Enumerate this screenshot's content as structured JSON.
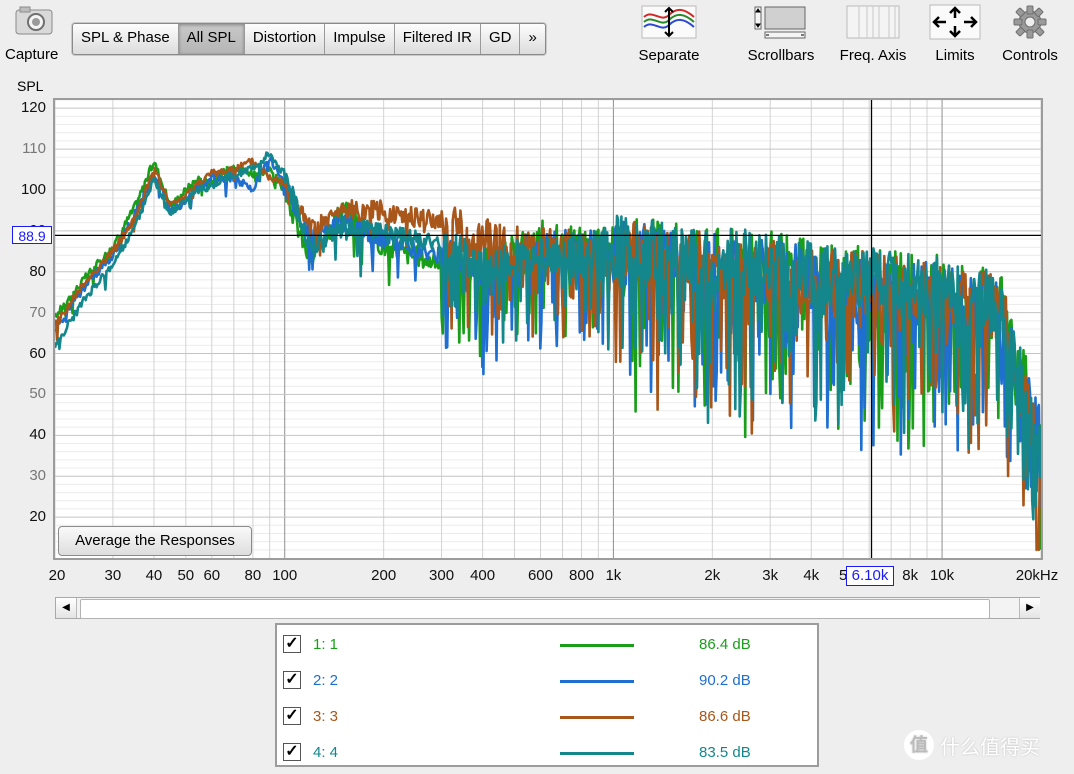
{
  "toolbar": {
    "capture_label": "Capture",
    "tabs": [
      "SPL & Phase",
      "All SPL",
      "Distortion",
      "Impulse",
      "Filtered IR",
      "GD",
      "»"
    ],
    "active_tab": "All SPL",
    "tools": [
      {
        "label": "Separate",
        "icon": "separate-traces-icon"
      },
      {
        "label": "Scrollbars",
        "icon": "scrollbars-icon"
      },
      {
        "label": "Freq. Axis",
        "icon": "freq-axis-icon"
      },
      {
        "label": "Limits",
        "icon": "limits-icon"
      },
      {
        "label": "Controls",
        "icon": "gear-icon"
      }
    ]
  },
  "chart": {
    "y_axis_label": "SPL",
    "y_cursor_readout": "88.9",
    "x_cursor_readout": "6.10k",
    "average_button_label": "Average the Responses"
  },
  "chart_data": {
    "type": "line",
    "x_scale": "log",
    "xlim": [
      20,
      20000
    ],
    "ylim": [
      10,
      122
    ],
    "ylabel": "SPL",
    "y_ticks": [
      "120",
      "110",
      "100",
      "90",
      "80",
      "70",
      "60",
      "50",
      "40",
      "30",
      "20"
    ],
    "x_ticks": [
      {
        "v": 20,
        "t": "20"
      },
      {
        "v": 30,
        "t": "30"
      },
      {
        "v": 40,
        "t": "40"
      },
      {
        "v": 50,
        "t": "50"
      },
      {
        "v": 60,
        "t": "60"
      },
      {
        "v": 80,
        "t": "80"
      },
      {
        "v": 100,
        "t": "100"
      },
      {
        "v": 200,
        "t": "200"
      },
      {
        "v": 300,
        "t": "300"
      },
      {
        "v": 400,
        "t": "400"
      },
      {
        "v": 600,
        "t": "600"
      },
      {
        "v": 800,
        "t": "800"
      },
      {
        "v": 1000,
        "t": "1k"
      },
      {
        "v": 2000,
        "t": "2k"
      },
      {
        "v": 3000,
        "t": "3k"
      },
      {
        "v": 4000,
        "t": "4k"
      },
      {
        "v": 5000,
        "t": "5"
      },
      {
        "v": 8000,
        "t": "8k"
      },
      {
        "v": 10000,
        "t": "10k"
      },
      {
        "v": 20000,
        "t": "20kHz"
      }
    ],
    "cursor": {
      "x": 6100,
      "y": 88.9
    },
    "grid": true,
    "series": [
      {
        "name": "1: 1",
        "color": "#1a9e1a",
        "level": "86.4 dB",
        "x": [
          20,
          25,
          30,
          35,
          40,
          45,
          50,
          55,
          60,
          70,
          80,
          90,
          100,
          120,
          150,
          200,
          300,
          400,
          600,
          800,
          1000,
          1500,
          2000,
          3000,
          4000,
          5000,
          6000,
          8000,
          10000,
          15000,
          20000
        ],
        "y": [
          69,
          79,
          86,
          96,
          107,
          96,
          100,
          103,
          102,
          106,
          104,
          105,
          100,
          82,
          96,
          86,
          82,
          80,
          88,
          86,
          86,
          85,
          83,
          82,
          80,
          79,
          78,
          77,
          76,
          72,
          40
        ]
      },
      {
        "name": "2: 2",
        "color": "#1f6fd0",
        "level": "90.2 dB",
        "x": [
          20,
          25,
          30,
          35,
          40,
          45,
          50,
          55,
          60,
          70,
          80,
          90,
          100,
          120,
          150,
          200,
          300,
          400,
          600,
          800,
          1000,
          1500,
          2000,
          3000,
          4000,
          5000,
          6000,
          8000,
          10000,
          15000,
          20000
        ],
        "y": [
          66,
          77,
          84,
          94,
          104,
          95,
          97,
          101,
          103,
          103,
          100,
          108,
          101,
          88,
          92,
          88,
          84,
          80,
          85,
          86,
          85,
          84,
          82,
          80,
          78,
          77,
          76,
          75,
          74,
          70,
          38
        ]
      },
      {
        "name": "3: 3",
        "color": "#a8561a",
        "level": "86.6 dB",
        "x": [
          20,
          25,
          30,
          35,
          40,
          45,
          50,
          55,
          60,
          70,
          80,
          90,
          100,
          120,
          150,
          200,
          300,
          400,
          600,
          800,
          1000,
          1500,
          2000,
          3000,
          4000,
          5000,
          6000,
          8000,
          10000,
          15000,
          20000
        ],
        "y": [
          67,
          78,
          85,
          93,
          105,
          96,
          99,
          102,
          104,
          105,
          107,
          103,
          102,
          90,
          95,
          95,
          92,
          88,
          86,
          85,
          85,
          84,
          81,
          80,
          79,
          78,
          77,
          76,
          75,
          71,
          36
        ]
      },
      {
        "name": "4: 4",
        "color": "#14878c",
        "level": "83.5 dB",
        "x": [
          20,
          25,
          30,
          35,
          40,
          45,
          50,
          55,
          60,
          70,
          80,
          90,
          100,
          120,
          150,
          200,
          300,
          400,
          600,
          800,
          1000,
          1500,
          2000,
          3000,
          4000,
          5000,
          6000,
          8000,
          10000,
          15000,
          20000
        ],
        "y": [
          62,
          74,
          82,
          91,
          103,
          94,
          98,
          100,
          101,
          104,
          105,
          109,
          104,
          86,
          91,
          90,
          86,
          82,
          84,
          85,
          86,
          85,
          83,
          82,
          80,
          79,
          78,
          77,
          76,
          72,
          35
        ]
      }
    ]
  },
  "legend": {
    "items": [
      {
        "name": "1: 1",
        "value": "86.4 dB",
        "color": "#1a9e1a",
        "checked": true
      },
      {
        "name": "2: 2",
        "value": "90.2 dB",
        "color": "#1f6fd0",
        "checked": true
      },
      {
        "name": "3: 3",
        "value": "86.6 dB",
        "color": "#a8561a",
        "checked": true
      },
      {
        "name": "4: 4",
        "value": "83.5 dB",
        "color": "#14878c",
        "checked": true
      }
    ]
  },
  "watermark": {
    "badge": "值",
    "text": "什么值得买"
  }
}
